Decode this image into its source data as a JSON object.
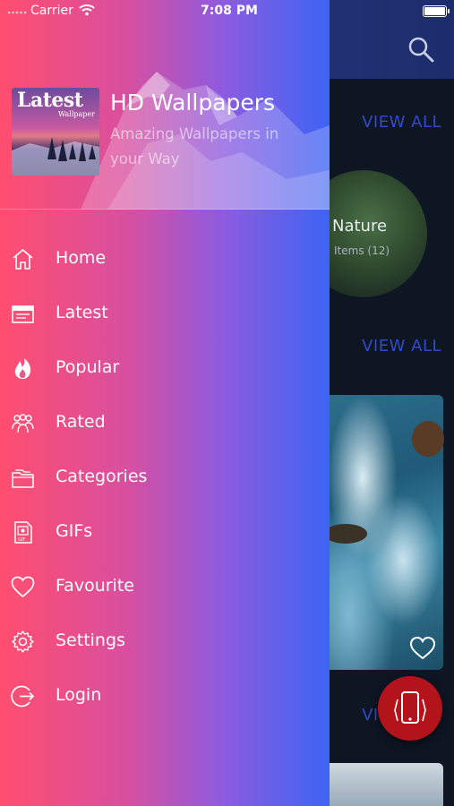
{
  "status_bar": {
    "carrier": "Carrier",
    "time": "7:08 PM"
  },
  "app": {
    "logo_title": "Latest",
    "logo_subtitle": "Wallpaper",
    "title": "HD Wallpapers",
    "subtitle": "Amazing Wallpapers in your Way"
  },
  "menu": {
    "items": [
      {
        "label": "Home",
        "icon": "home-icon"
      },
      {
        "label": "Latest",
        "icon": "calendar-icon"
      },
      {
        "label": "Popular",
        "icon": "fire-icon"
      },
      {
        "label": "Rated",
        "icon": "users-icon"
      },
      {
        "label": "Categories",
        "icon": "folder-icon"
      },
      {
        "label": "GIFs",
        "icon": "gif-file-icon"
      },
      {
        "label": "Favourite",
        "icon": "heart-icon"
      },
      {
        "label": "Settings",
        "icon": "gear-icon"
      },
      {
        "label": "Login",
        "icon": "login-icon"
      }
    ]
  },
  "background": {
    "view_all_1": "VIEW ALL",
    "view_all_2": "VIEW ALL",
    "view_all_3": "VIEW ALL",
    "category_name": "Nature",
    "category_items": "Items (12)"
  },
  "colors": {
    "drawer_gradient_start": "#ff4e6f",
    "drawer_gradient_end": "#3d64f5",
    "view_all": "#3349c8",
    "fab": "#b3141b"
  }
}
